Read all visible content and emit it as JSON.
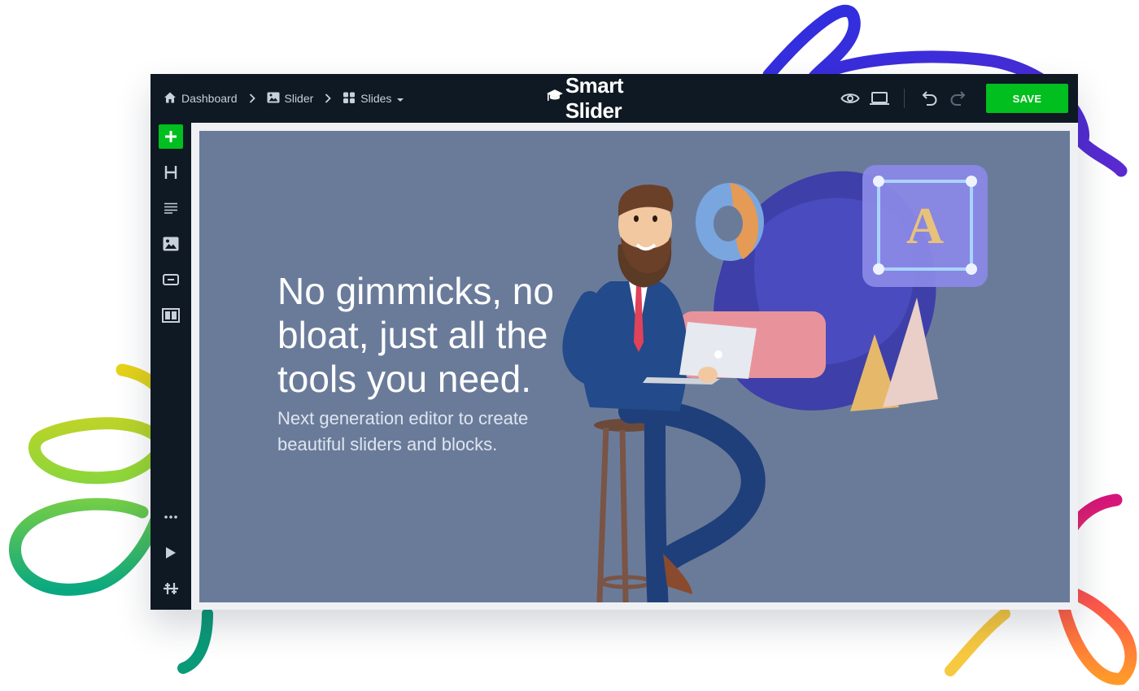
{
  "breadcrumb": {
    "items": [
      {
        "label": "Dashboard",
        "icon": "home-icon"
      },
      {
        "label": "Slider",
        "icon": "image-icon"
      },
      {
        "label": "Slides",
        "icon": "grid-icon"
      }
    ]
  },
  "logo": {
    "text": "Smart Slider"
  },
  "toolbar": {
    "save_label": "SAVE",
    "icons": [
      "eye-icon",
      "laptop-icon",
      "undo-icon",
      "redo-icon"
    ]
  },
  "sidebar": {
    "icons": [
      "plus-icon",
      "heading-icon",
      "text-icon",
      "image-icon",
      "button-icon",
      "columns-icon",
      "more-icon",
      "play-icon",
      "structure-icon"
    ]
  },
  "slide": {
    "headline": "No gimmicks, no bloat, just all the tools you need.",
    "subline": "Next generation editor to create beautiful sliders and blocks.",
    "badge_letter": "A",
    "background": "#6a7b9a"
  },
  "colors": {
    "topbar": "#0f1923",
    "save": "#00bf1e",
    "canvas": "#6a7b9a"
  }
}
